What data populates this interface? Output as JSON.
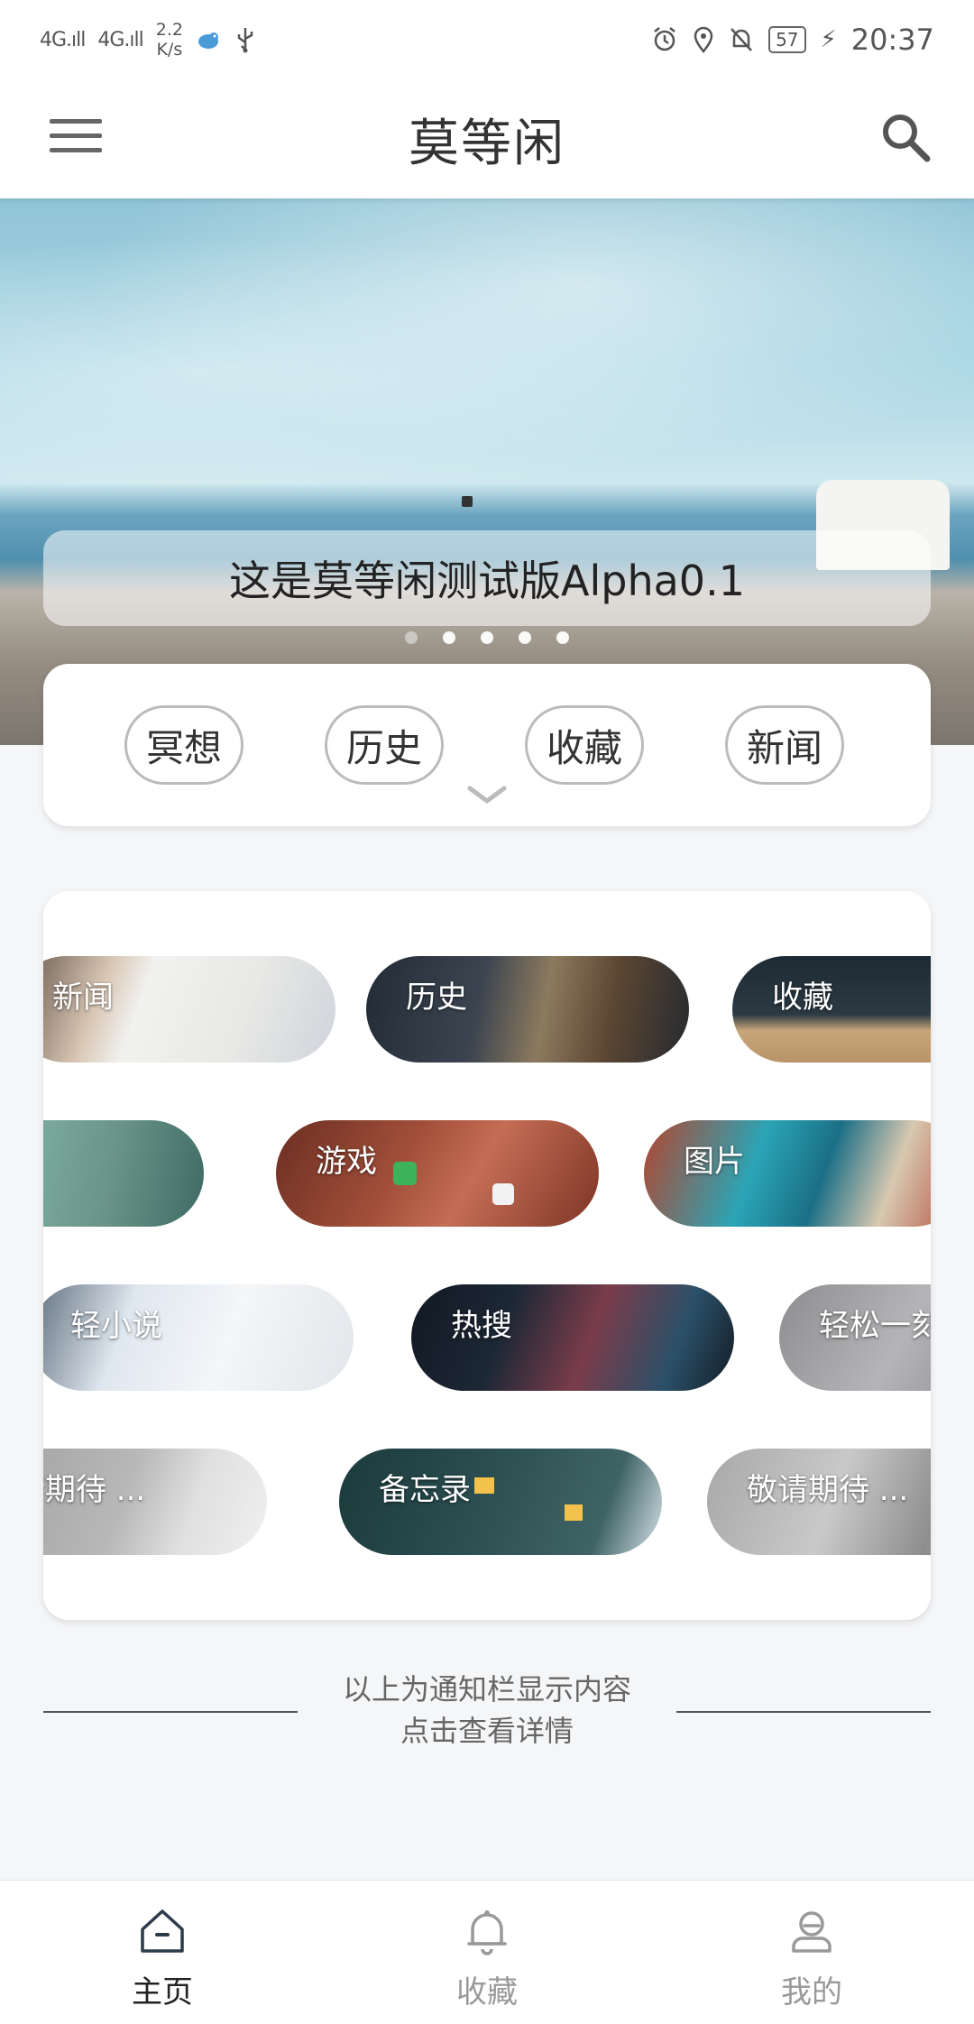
{
  "status_bar": {
    "signal1": "4G.ıll",
    "signal2": "4G.ıll",
    "speed_value": "2.2",
    "speed_unit": "K/s",
    "battery": "57",
    "time": "20:37"
  },
  "app_bar": {
    "title": "莫等闲"
  },
  "banner": {
    "caption": "这是莫等闲测试版Alpha0.1",
    "page_count": 5,
    "active_page": 1
  },
  "quick_links": [
    "冥想",
    "历史",
    "收藏",
    "新闻"
  ],
  "tiles": [
    {
      "label": "新闻"
    },
    {
      "label": "历史"
    },
    {
      "label": "收藏"
    },
    {
      "label": ""
    },
    {
      "label": "游戏"
    },
    {
      "label": "图片"
    },
    {
      "label": "轻小说"
    },
    {
      "label": "热搜"
    },
    {
      "label": "轻松一刻"
    },
    {
      "label": "敬请期待 ..."
    },
    {
      "label": "备忘录"
    },
    {
      "label": "敬请期待 ..."
    }
  ],
  "footer_note": {
    "line1": "以上为通知栏显示内容",
    "line2": "点击查看详情"
  },
  "bottom_nav": [
    {
      "label": "主页",
      "icon": "home-icon",
      "active": true
    },
    {
      "label": "收藏",
      "icon": "bell-icon",
      "active": false
    },
    {
      "label": "我的",
      "icon": "profile-icon",
      "active": false
    }
  ],
  "colors": {
    "accent": "#2c3a4a",
    "background": "#f5f6f8",
    "card": "#ffffff"
  }
}
